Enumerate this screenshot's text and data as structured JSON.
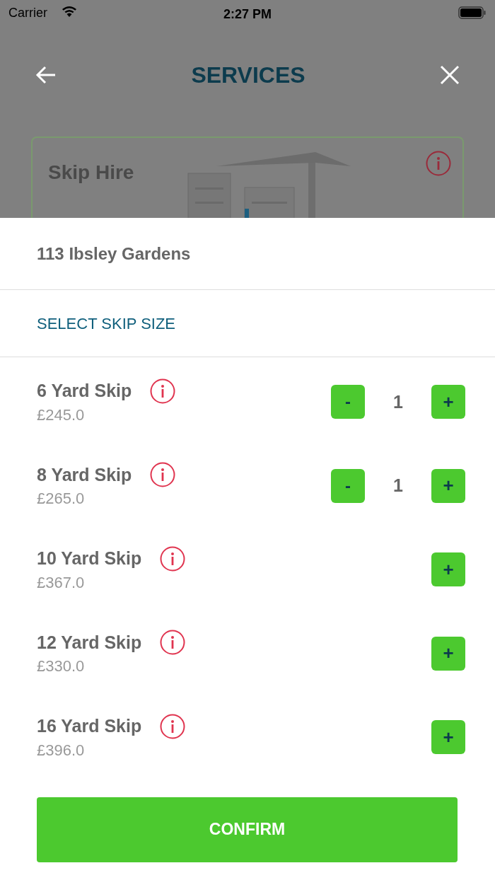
{
  "status_bar": {
    "carrier": "Carrier",
    "time": "2:27 PM"
  },
  "header": {
    "title": "SERVICES"
  },
  "service_card": {
    "title": "Skip Hire"
  },
  "sheet": {
    "address": "113 Ibsley Gardens",
    "section_title": "SELECT SKIP SIZE",
    "items": [
      {
        "name": "6 Yard Skip",
        "price": "£245.0",
        "minus": "-",
        "quantity": "1",
        "plus": "+"
      },
      {
        "name": "8 Yard Skip",
        "price": "£265.0",
        "minus": "-",
        "quantity": "1",
        "plus": "+"
      },
      {
        "name": "10 Yard Skip",
        "price": "£367.0",
        "plus": "+"
      },
      {
        "name": "12 Yard Skip",
        "price": "£330.0",
        "plus": "+"
      },
      {
        "name": "16 Yard Skip",
        "price": "£396.0",
        "plus": "+"
      }
    ],
    "confirm": "CONFIRM"
  }
}
